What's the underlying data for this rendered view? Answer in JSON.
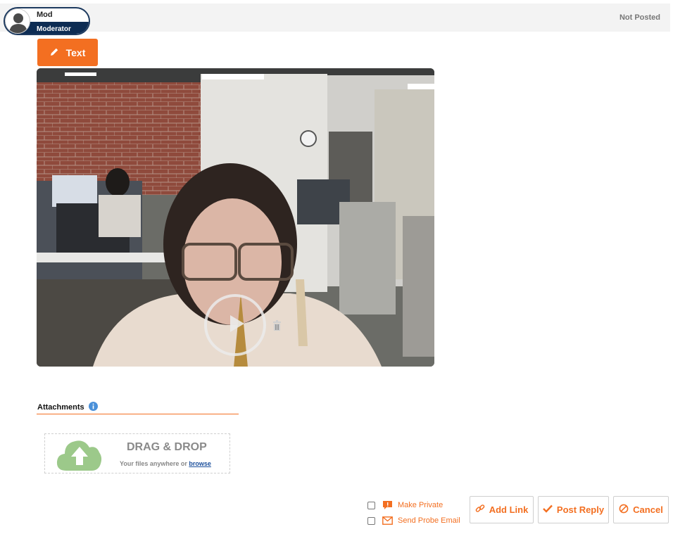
{
  "user": {
    "name": "Mod",
    "role": "Moderator"
  },
  "status": "Not Posted",
  "text_button": "Text",
  "attachments": {
    "title": "Attachments",
    "drop_title": "DRAG & DROP",
    "drop_sub": "Your files anywhere or",
    "browse": "browse"
  },
  "options": {
    "make_private": "Make Private",
    "send_probe_email": "Send Probe Email"
  },
  "actions": {
    "add_link": "Add Link",
    "post_reply": "Post Reply",
    "cancel": "Cancel"
  },
  "colors": {
    "accent": "#f36f21",
    "navy": "#0d2c53",
    "cloud": "#9cc98a",
    "info": "#4a90d9"
  },
  "icons": [
    "avatar-icon",
    "pencil-icon",
    "play-icon",
    "trash-icon",
    "info-icon",
    "upload-cloud-icon",
    "chat-icon",
    "mail-icon",
    "link-icon",
    "check-icon",
    "cancel-icon"
  ]
}
